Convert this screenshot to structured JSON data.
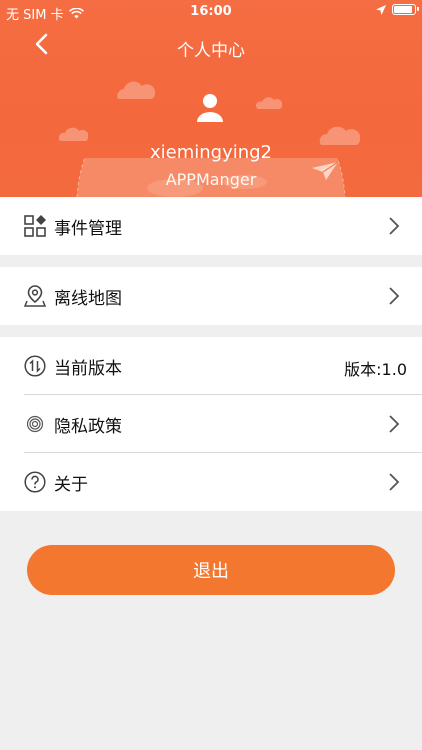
{
  "status_bar": {
    "carrier": "无 SIM 卡",
    "time": "16:00"
  },
  "nav": {
    "title": "个人中心"
  },
  "profile": {
    "username": "xiemingying2",
    "app_name": "APPManger"
  },
  "menu": {
    "event_management": "事件管理",
    "offline_map": "离线地图",
    "current_version": "当前版本",
    "version_value": "版本:1.0",
    "privacy_policy": "隐私政策",
    "about": "关于"
  },
  "logout_label": "退出",
  "colors": {
    "header": "#f56d42",
    "accent": "#f3772f",
    "background": "#efefef"
  },
  "icons": {
    "back": "chevron-left-icon",
    "avatar": "user-icon",
    "events": "grid-icon",
    "map": "map-pin-icon",
    "version": "updown-icon",
    "privacy": "fingerprint-icon",
    "about": "question-icon"
  }
}
